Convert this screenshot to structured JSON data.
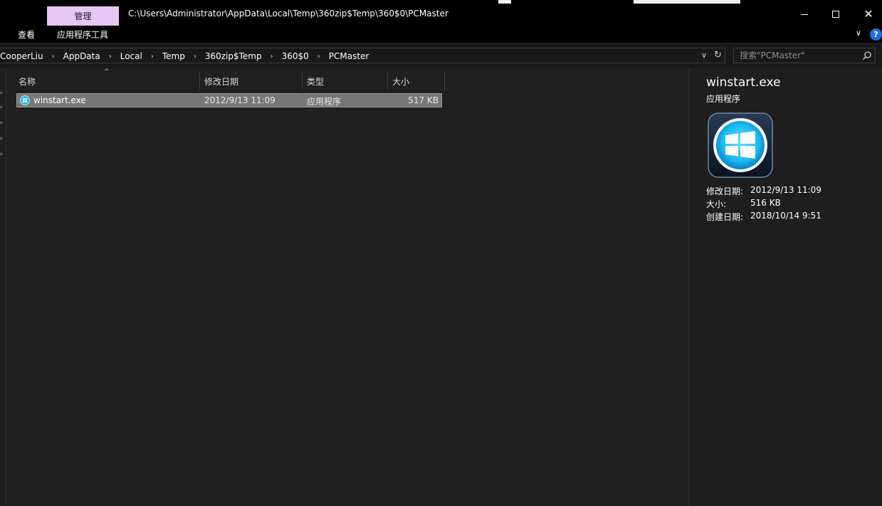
{
  "window": {
    "title": "C:\\Users\\Administrator\\AppData\\Local\\Temp\\360zip$Temp\\360$0\\PCMaster",
    "manage_tab": "管理",
    "minimize_icon": "minimize-icon",
    "maximize_icon": "maximize-icon",
    "close_icon": "close-icon",
    "close_glyph": "✕"
  },
  "ribbon": {
    "view_tab": "查看",
    "app_tools_tab": "应用程序工具",
    "chevron": "∨",
    "help": "?"
  },
  "address_bar": {
    "crumbs": [
      "CooperLiu",
      "AppData",
      "Local",
      "Temp",
      "360zip$Temp",
      "360$0",
      "PCMaster"
    ],
    "separator": "›",
    "dropdown": "∨",
    "refresh": "↻"
  },
  "search": {
    "placeholder": "搜索\"PCMaster\""
  },
  "columns": {
    "name": "名称",
    "modified": "修改日期",
    "type": "类型",
    "size": "大小",
    "sort_arrow": "^"
  },
  "files": [
    {
      "name": "winstart.exe",
      "modified": "2012/9/13 11:09",
      "type": "应用程序",
      "size": "517 KB"
    }
  ],
  "details": {
    "name": "winstart.exe",
    "type": "应用程序",
    "modified_label": "修改日期:",
    "modified_value": "2012/9/13 11:09",
    "size_label": "大小:",
    "size_value": "516 KB",
    "created_label": "创建日期:",
    "created_value": "2018/10/14 9:51"
  },
  "colors": {
    "manage_accent": "#e6c6f5",
    "selection": "#777777",
    "help_blue": "#1e6fd9",
    "icon_cyan": "#19b9f0"
  }
}
